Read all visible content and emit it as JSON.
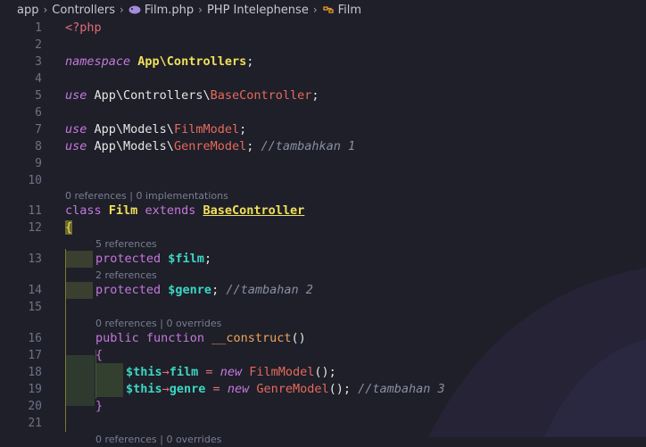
{
  "breadcrumb": {
    "items": [
      "app",
      "Controllers",
      "Film.php",
      "PHP Intelephense",
      "Film"
    ],
    "icons": [
      "php-elephant-icon",
      "class-symbol-icon"
    ]
  },
  "editor": {
    "line_numbers": [
      "1",
      "2",
      "3",
      "4",
      "5",
      "6",
      "7",
      "8",
      "9",
      "10",
      "11",
      "12",
      "13",
      "14",
      "15",
      "16",
      "17",
      "18",
      "19",
      "20",
      "21"
    ],
    "code": {
      "l1": "<?php",
      "l3_kw": "namespace",
      "l3_ns": "App\\Controllers",
      "l3_end": ";",
      "l5_kw": "use",
      "l5_path": "App\\Controllers\\",
      "l5_cls": "BaseController",
      "l5_end": ";",
      "l7_kw": "use",
      "l7_path": "App\\Models\\",
      "l7_cls": "FilmModel",
      "l7_end": ";",
      "l8_kw": "use",
      "l8_path": "App\\Models\\",
      "l8_cls": "GenreModel",
      "l8_end": ";",
      "l8_comment": "//tambahkan 1",
      "l11_class": "class",
      "l11_name": "Film",
      "l11_extends": "extends",
      "l11_parent": "BaseController",
      "l12": "{",
      "l13_kw": "protected",
      "l13_var": "$film",
      "l13_end": ";",
      "l14_kw": "protected",
      "l14_var": "$genre",
      "l14_end": ";",
      "l14_comment": "//tambahan 2",
      "l16_kw1": "public",
      "l16_kw2": "function",
      "l16_fn": "__construct",
      "l16_paren": "()",
      "l17": "{",
      "l18_this": "$this",
      "l18_arrow": "→",
      "l18_prop": "film",
      "l18_eq": " = ",
      "l18_new": "new",
      "l18_cls": "FilmModel",
      "l18_end": "();",
      "l19_this": "$this",
      "l19_arrow": "→",
      "l19_prop": "genre",
      "l19_eq": " = ",
      "l19_new": "new",
      "l19_cls": "GenreModel",
      "l19_end": "();",
      "l19_comment": "//tambahan 3",
      "l20": "}"
    },
    "code_lens": {
      "class_refs": "0 references | 0 implementations",
      "film_refs": "5 references",
      "genre_refs": "2 references",
      "construct_refs": "0 references | 0 overrides",
      "next_refs": "0 references | 0 overrides"
    }
  },
  "colors": {
    "background": "#1e1f29",
    "keyword": "#c678dd",
    "namespace": "#f1e05a",
    "class_ref": "#e76a5a",
    "variable": "#3bd7c3",
    "comment": "#8a8fa3",
    "line_number": "#6e7288"
  }
}
